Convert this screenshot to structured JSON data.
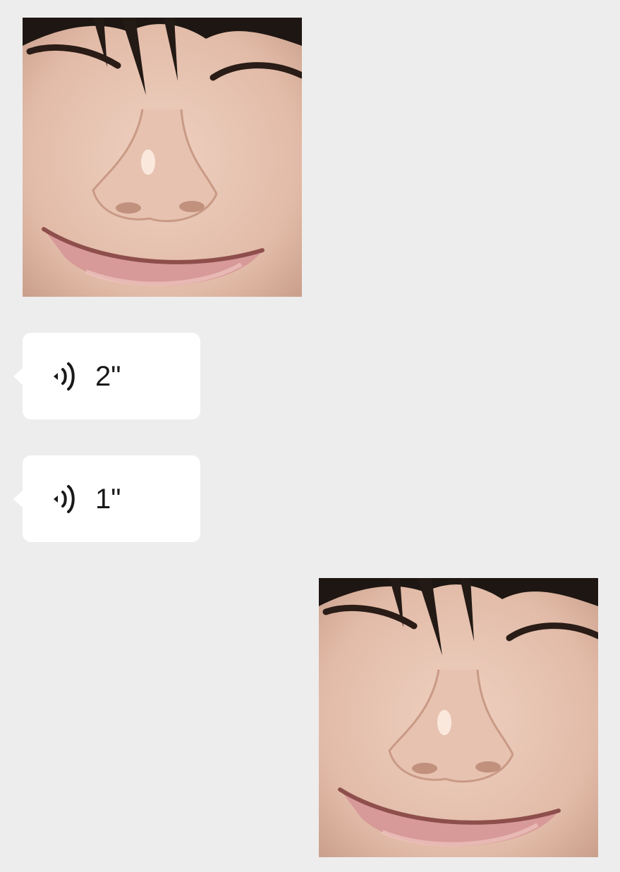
{
  "messages": [
    {
      "type": "image",
      "side": "left",
      "icon": "photo-smiling-face"
    },
    {
      "type": "voice",
      "side": "left",
      "duration": "2\"",
      "icon": "voice-wave-icon"
    },
    {
      "type": "voice",
      "side": "left",
      "duration": "1\"",
      "icon": "voice-wave-icon"
    },
    {
      "type": "image",
      "side": "right",
      "icon": "photo-smiling-face"
    }
  ],
  "colors": {
    "background": "#ededed",
    "bubble": "#ffffff",
    "text": "#191919"
  }
}
